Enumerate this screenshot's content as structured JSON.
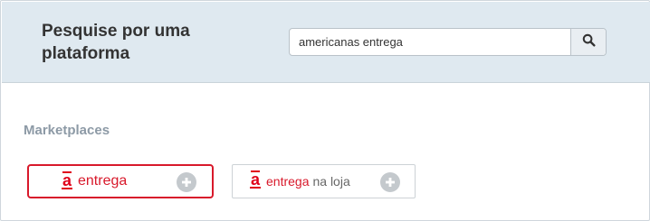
{
  "header": {
    "title": "Pesquise por uma plataforma"
  },
  "search": {
    "value": "americanas entrega",
    "button_icon": "search-icon"
  },
  "section": {
    "title": "Marketplaces"
  },
  "marketplaces": [
    {
      "logo_letter": "a",
      "name": "entrega",
      "suffix": "",
      "selected": true,
      "icon": "plus-circle-icon"
    },
    {
      "logo_letter": "a",
      "name": "entrega",
      "suffix": "na loja",
      "selected": false,
      "icon": "plus-circle-icon"
    }
  ],
  "colors": {
    "header_bg": "#dfe9f0",
    "brand_red": "#e0001b",
    "selected_border": "#d8192b",
    "section_title": "#8d9aa6",
    "plus_icon": "#c4c9cd"
  }
}
